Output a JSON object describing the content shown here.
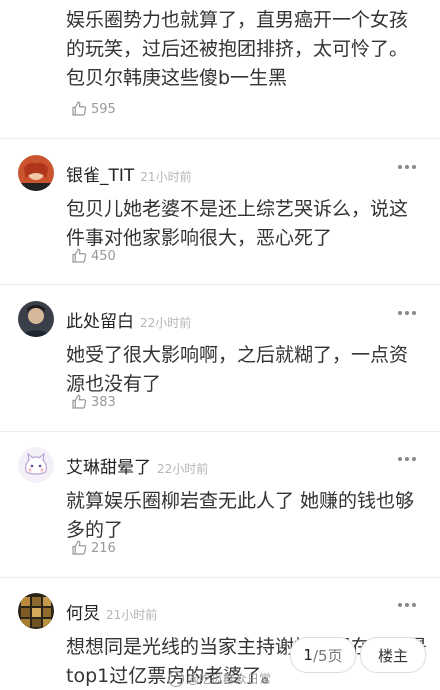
{
  "top_comment": {
    "text": "娱乐圈势力也就算了，直男癌开一个女孩的玩笑，过后还被抱团排挤，太可怜了。包贝尔韩庚这些傻b一生黑",
    "likes": "595"
  },
  "comments": [
    {
      "username": "银雀_TIT",
      "time": "21小时前",
      "text": "包贝儿她老婆不是还上综艺哭诉么，说这件事对他家影响很大，恶心死了",
      "likes": "450"
    },
    {
      "username": "此处留白",
      "time": "22小时前",
      "text": "她受了很大影响啊，之后就糊了，一点资源也没有了",
      "likes": "383"
    },
    {
      "username": "艾琳甜晕了",
      "time": "22小时前",
      "text": "就算娱乐圈柳岩查无此人了 她赚的钱也够多的了",
      "likes": "216"
    },
    {
      "username": "何炅",
      "time": "21小时前",
      "text": "想想同是光线的当家主持谢楠，现在已经是top1过亿票房的老婆了。"
    }
  ],
  "pager": {
    "current": "1",
    "rest": "/5页"
  },
  "host_button": "楼主",
  "watermark": "@吃瓜群众日常"
}
